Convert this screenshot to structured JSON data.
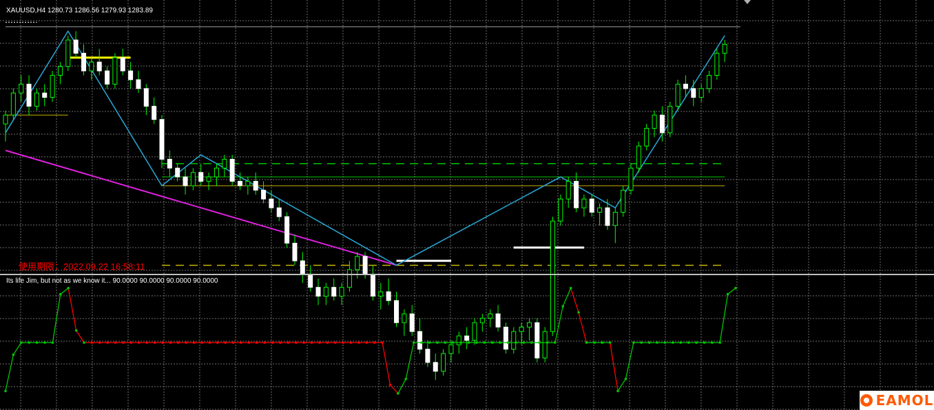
{
  "chart_data": [
    {
      "type": "candlestick",
      "title": "XAUUSD,H4",
      "ohlc_text": "1280.73 1286.56 1279.93 1283.89",
      "expiry_text": "使用期限：2022.09.22 16:58:11",
      "grid": true,
      "ylim": [
        1235,
        1292
      ],
      "candles": [
        [
          1268,
          1271,
          1264,
          1270
        ],
        [
          1270,
          1276,
          1269,
          1275
        ],
        [
          1275,
          1279,
          1273,
          1277
        ],
        [
          1277,
          1279,
          1270,
          1272
        ],
        [
          1272,
          1276,
          1271,
          1275
        ],
        [
          1275,
          1277,
          1272,
          1274
        ],
        [
          1274,
          1280,
          1273,
          1279
        ],
        [
          1279,
          1282,
          1277,
          1281
        ],
        [
          1281,
          1288,
          1280,
          1287
        ],
        [
          1287,
          1289,
          1283,
          1284
        ],
        [
          1284,
          1286,
          1279,
          1280
        ],
        [
          1280,
          1283,
          1278,
          1282
        ],
        [
          1282,
          1285,
          1279,
          1280
        ],
        [
          1280,
          1281,
          1276,
          1277
        ],
        [
          1277,
          1284,
          1276,
          1283
        ],
        [
          1283,
          1285,
          1279,
          1280
        ],
        [
          1280,
          1282,
          1276,
          1278
        ],
        [
          1278,
          1280,
          1275,
          1276
        ],
        [
          1276,
          1277,
          1270,
          1272
        ],
        [
          1272,
          1274,
          1268,
          1269
        ],
        [
          1269,
          1270,
          1258,
          1260
        ],
        [
          1260,
          1262,
          1256,
          1258
        ],
        [
          1258,
          1259,
          1255,
          1256
        ],
        [
          1256,
          1258,
          1252,
          1254
        ],
        [
          1254,
          1258,
          1253,
          1257
        ],
        [
          1257,
          1259,
          1254,
          1255
        ],
        [
          1255,
          1257,
          1253,
          1256
        ],
        [
          1256,
          1259,
          1254,
          1258
        ],
        [
          1258,
          1261,
          1256,
          1260
        ],
        [
          1260,
          1261,
          1254,
          1255
        ],
        [
          1255,
          1257,
          1253,
          1254
        ],
        [
          1254,
          1256,
          1252,
          1255
        ],
        [
          1255,
          1257,
          1252,
          1253
        ],
        [
          1253,
          1255,
          1250,
          1251
        ],
        [
          1251,
          1253,
          1248,
          1249
        ],
        [
          1249,
          1251,
          1246,
          1247
        ],
        [
          1247,
          1248,
          1240,
          1241
        ],
        [
          1241,
          1243,
          1236,
          1237
        ],
        [
          1237,
          1239,
          1232,
          1234
        ],
        [
          1234,
          1236,
          1230,
          1231
        ],
        [
          1231,
          1233,
          1227,
          1229
        ],
        [
          1229,
          1232,
          1227,
          1231
        ],
        [
          1231,
          1233,
          1228,
          1229
        ],
        [
          1229,
          1232,
          1227,
          1231
        ],
        [
          1231,
          1237,
          1230,
          1235
        ],
        [
          1235,
          1239,
          1233,
          1238
        ],
        [
          1238,
          1239,
          1233,
          1234
        ],
        [
          1234,
          1236,
          1228,
          1229
        ],
        [
          1229,
          1232,
          1226,
          1230
        ],
        [
          1230,
          1233,
          1227,
          1228
        ],
        [
          1228,
          1230,
          1222,
          1223
        ],
        [
          1223,
          1226,
          1220,
          1225
        ],
        [
          1225,
          1227,
          1220,
          1221
        ],
        [
          1221,
          1224,
          1216,
          1217
        ],
        [
          1217,
          1219,
          1213,
          1214
        ],
        [
          1214,
          1216,
          1210,
          1212
        ],
        [
          1212,
          1217,
          1211,
          1216
        ],
        [
          1216,
          1219,
          1214,
          1218
        ],
        [
          1218,
          1221,
          1216,
          1220
        ],
        [
          1220,
          1222,
          1217,
          1219
        ],
        [
          1219,
          1224,
          1218,
          1223
        ],
        [
          1223,
          1225,
          1221,
          1224
        ],
        [
          1224,
          1226,
          1222,
          1225
        ],
        [
          1225,
          1227,
          1221,
          1222
        ],
        [
          1222,
          1223,
          1216,
          1217
        ],
        [
          1217,
          1222,
          1216,
          1221
        ],
        [
          1221,
          1223,
          1218,
          1222
        ],
        [
          1222,
          1224,
          1219,
          1223
        ],
        [
          1223,
          1224,
          1214,
          1215
        ],
        [
          1215,
          1222,
          1214,
          1221
        ],
        [
          1221,
          1247,
          1220,
          1246
        ],
        [
          1246,
          1252,
          1245,
          1251
        ],
        [
          1251,
          1256,
          1249,
          1255
        ],
        [
          1255,
          1257,
          1248,
          1249
        ],
        [
          1249,
          1252,
          1247,
          1251
        ],
        [
          1251,
          1252,
          1247,
          1248
        ],
        [
          1248,
          1250,
          1245,
          1249
        ],
        [
          1249,
          1251,
          1244,
          1245
        ],
        [
          1245,
          1249,
          1241,
          1248
        ],
        [
          1248,
          1254,
          1247,
          1253
        ],
        [
          1253,
          1259,
          1252,
          1258
        ],
        [
          1258,
          1264,
          1257,
          1263
        ],
        [
          1263,
          1268,
          1262,
          1267
        ],
        [
          1267,
          1271,
          1265,
          1270
        ],
        [
          1270,
          1272,
          1264,
          1266
        ],
        [
          1266,
          1273,
          1265,
          1272
        ],
        [
          1272,
          1278,
          1271,
          1277
        ],
        [
          1277,
          1279,
          1274,
          1276
        ],
        [
          1276,
          1278,
          1272,
          1274
        ],
        [
          1274,
          1277,
          1273,
          1276
        ],
        [
          1276,
          1280,
          1275,
          1279
        ],
        [
          1279,
          1285,
          1278,
          1284
        ],
        [
          1284,
          1287,
          1282,
          1286
        ]
      ],
      "zigzag": [
        [
          0,
          1266
        ],
        [
          8,
          1289
        ],
        [
          20,
          1254
        ],
        [
          25,
          1261
        ],
        [
          50,
          1236
        ],
        [
          71,
          1256
        ],
        [
          78,
          1249
        ],
        [
          92,
          1288
        ]
      ],
      "trendline": [
        [
          0,
          1262
        ],
        [
          50,
          1236
        ]
      ],
      "levels": [
        {
          "from": 0,
          "to": 8,
          "value": 1270,
          "color": "#c8b400",
          "style": "solid"
        },
        {
          "from": 8,
          "to": 16,
          "value": 1283,
          "color": "#ffff00",
          "style": "thick"
        },
        {
          "from": 20,
          "to": 92,
          "value": 1259,
          "color": "#00c800",
          "style": "dashed"
        },
        {
          "from": 20,
          "to": 92,
          "value": 1256,
          "color": "#00c800",
          "style": "solid"
        },
        {
          "from": 20,
          "to": 92,
          "value": 1254,
          "color": "#c8b400",
          "style": "solid"
        },
        {
          "from": 20,
          "to": 92,
          "value": 1236,
          "color": "#c8b400",
          "style": "dashed"
        },
        {
          "from": 50,
          "to": 57,
          "value": 1237,
          "color": "#ffffff",
          "style": "thick"
        },
        {
          "from": 65,
          "to": 74,
          "value": 1240,
          "color": "#ffffff",
          "style": "thick"
        },
        {
          "from": 0,
          "to": 94,
          "value": 1290,
          "color": "#a0a0a0",
          "style": "solid"
        },
        {
          "from": 0,
          "to": 4,
          "value": 1291,
          "color": "#ffffff",
          "style": "dotted"
        }
      ]
    },
    {
      "type": "line",
      "title": "Its life Jim, but not as we know it...",
      "values_text": "90.0000 90.0000 90.0000 90.0000",
      "ylim": [
        0,
        100
      ],
      "values": [
        10,
        40,
        50,
        50,
        50,
        50,
        50,
        90,
        95,
        60,
        50,
        50,
        50,
        50,
        50,
        50,
        50,
        50,
        50,
        50,
        50,
        50,
        50,
        50,
        50,
        50,
        50,
        50,
        50,
        50,
        50,
        50,
        50,
        50,
        50,
        50,
        50,
        50,
        50,
        50,
        50,
        50,
        50,
        50,
        50,
        50,
        50,
        50,
        50,
        15,
        8,
        20,
        50,
        50,
        50,
        50,
        50,
        50,
        50,
        50,
        50,
        50,
        50,
        50,
        50,
        50,
        50,
        50,
        50,
        50,
        50,
        80,
        95,
        75,
        50,
        50,
        50,
        50,
        10,
        20,
        50,
        50,
        50,
        50,
        50,
        50,
        50,
        50,
        50,
        50,
        50,
        50,
        90,
        95
      ],
      "colors": [
        "#00c800",
        "#ff0000"
      ]
    }
  ]
}
